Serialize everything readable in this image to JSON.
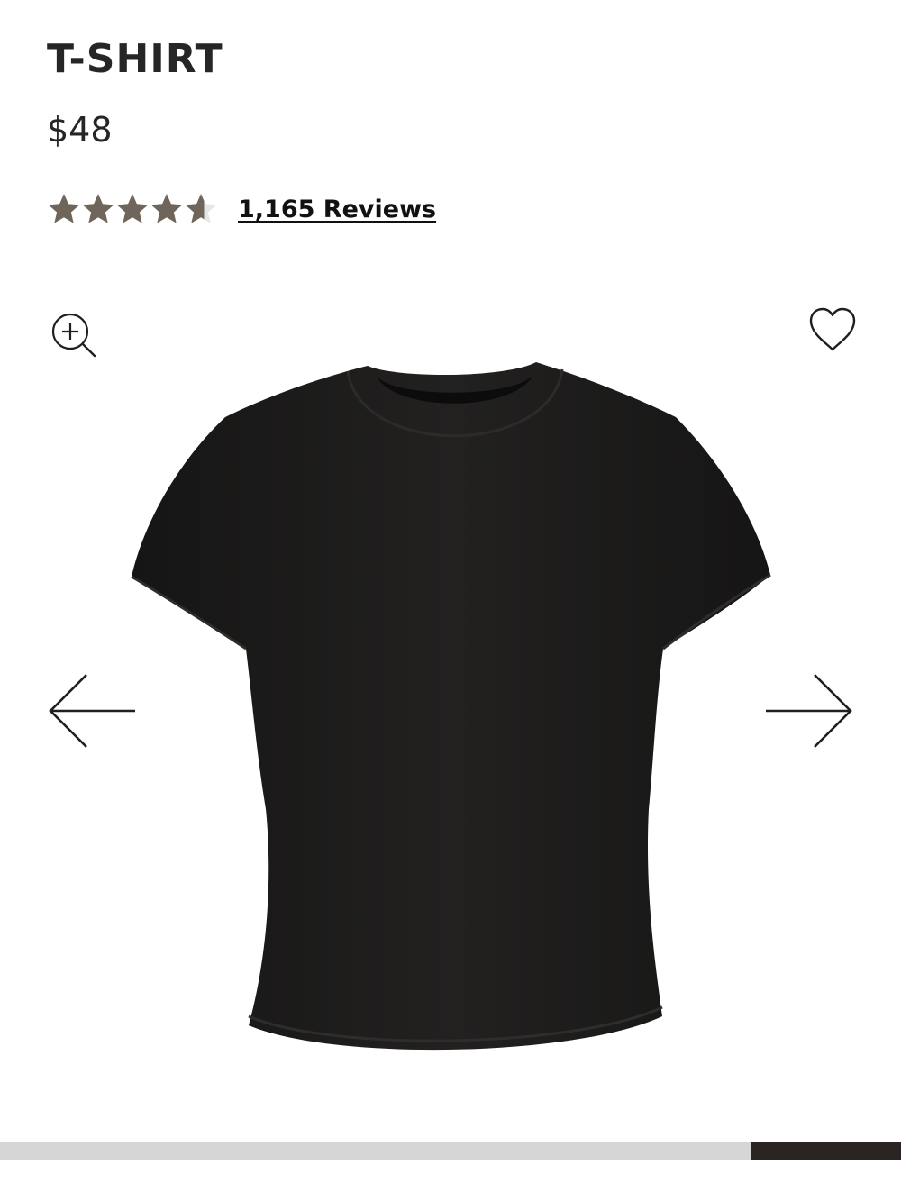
{
  "product": {
    "title": "T-SHIRT",
    "price": "$48",
    "rating": 4.6,
    "rating_max": 5,
    "reviews_label": "1,165 Reviews"
  },
  "icons": {
    "zoom": "zoom-in-icon",
    "wishlist": "heart-icon",
    "prev": "arrow-left-icon",
    "next": "arrow-right-icon"
  },
  "carousel": {
    "progress_start": 0.833,
    "progress_end": 1.0
  },
  "colors": {
    "star_fill": "#6f655b",
    "star_empty": "#e6e6e6",
    "progress_track": "#d6d6d6",
    "progress_fill": "#2a2522",
    "garment": "#1c1b1a"
  }
}
